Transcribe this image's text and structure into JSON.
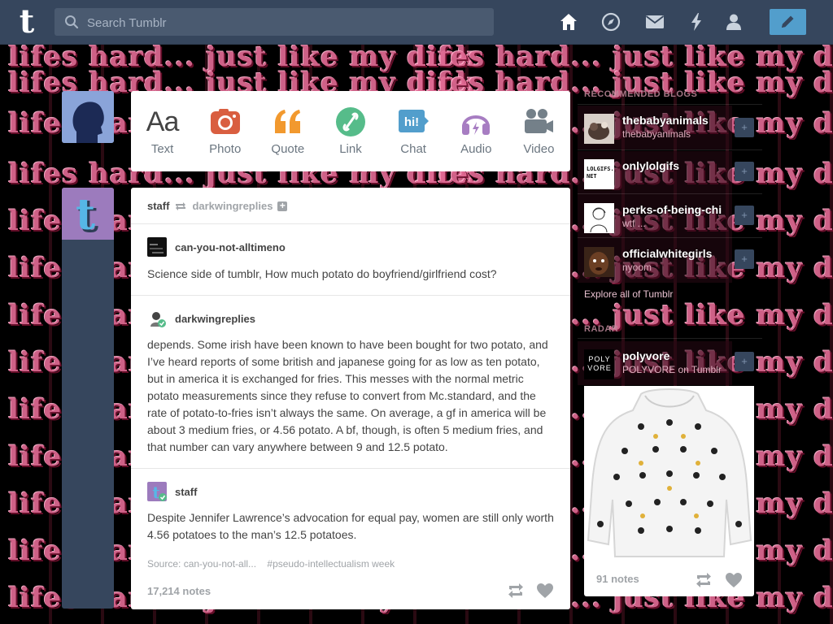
{
  "header": {
    "search_placeholder": "Search Tumblr",
    "logo_letter": "t",
    "icons": [
      "home-icon",
      "explore-icon",
      "inbox-icon",
      "activity-icon",
      "account-icon",
      "compose-icon"
    ]
  },
  "background": {
    "banner_text": "lifes hard... just like my dick"
  },
  "composer": {
    "items": [
      {
        "label": "Text",
        "icon": "text-icon",
        "color": "#444444"
      },
      {
        "label": "Photo",
        "icon": "photo-icon",
        "color": "#d95e40"
      },
      {
        "label": "Quote",
        "icon": "quote-icon",
        "color": "#f2992e"
      },
      {
        "label": "Link",
        "icon": "link-icon",
        "color": "#56bc8a"
      },
      {
        "label": "Chat",
        "icon": "chat-icon",
        "color": "#529ecc"
      },
      {
        "label": "Audio",
        "icon": "audio-icon",
        "color": "#a77dc2"
      },
      {
        "label": "Video",
        "icon": "video-icon",
        "color": "#748089"
      }
    ]
  },
  "post": {
    "author": "staff",
    "reblogged_from": "darkwingreplies",
    "chain": [
      {
        "name": "can-you-not-alltimeno",
        "text": "Science side of tumblr, How much potato do boyfriend/girlfriend cost?"
      },
      {
        "name": "darkwingreplies",
        "text": "depends. Some irish have been known to have been bought for two potato, and I’ve heard reports of some british and japanese going for as low as ten potato, but in america it is exchanged for fries. This messes with the normal metric potato measurements since they refuse to convert from Mc.standard, and the rate of potato-to-fries isn’t always the same. On average, a gf in america will be about 3 medium fries, or 4.56 potato. A bf, though, is often 5 medium fries, and that number can vary anywhere between 9 and 12.5 potato."
      },
      {
        "name": "staff",
        "text": "Despite Jennifer Lawrence’s advocation for equal pay, women are still only worth 4.56 potatoes to the man’s 12.5 potatoes."
      }
    ],
    "source": "Source: can-you-not-all...",
    "tag": "#pseudo-intellectualism week",
    "notes": "17,214 notes"
  },
  "sidebar": {
    "recommended_heading": "RECOMMENDED BLOGS",
    "blogs": [
      {
        "name": "thebabyanimals",
        "sub": "thebabyanimals"
      },
      {
        "name": "onlylolgifs",
        "sub": ""
      },
      {
        "name": "perks-of-being-chi",
        "sub": "wtf ..."
      },
      {
        "name": "officialwhitegirls",
        "sub": "nyoom"
      }
    ],
    "explore_link": "Explore all of Tumblr",
    "radar_heading": "RADAR",
    "radar": {
      "name": "polyvore",
      "sub": "POLYVORE on Tumblr",
      "avatar_text": "POLY VORE",
      "notes": "91 notes"
    },
    "lolgifs_avatar_text": "LOLGIFS. NET"
  }
}
